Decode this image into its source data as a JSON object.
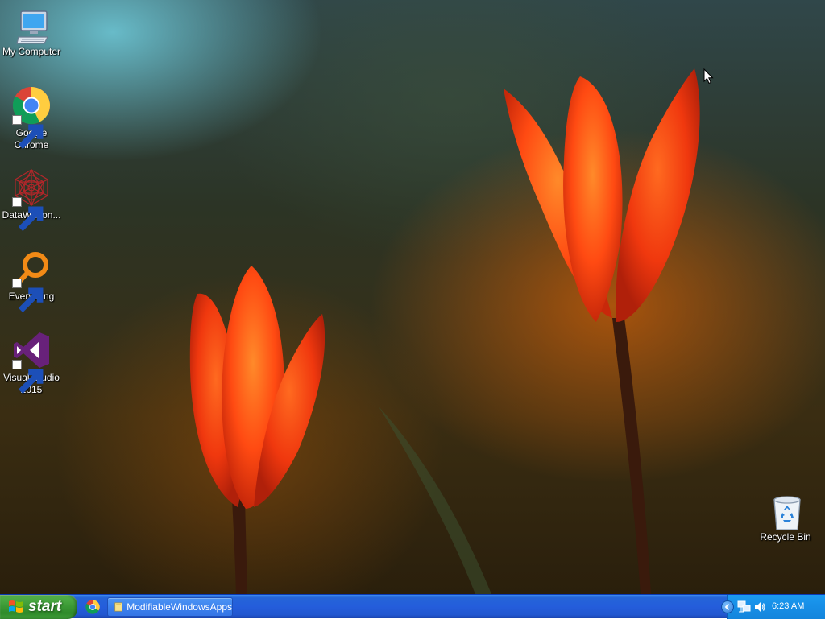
{
  "desktop": {
    "icons": [
      {
        "label": "My Computer",
        "icon": "my-computer-icon"
      },
      {
        "label": "Google Chrome",
        "icon": "chrome-icon"
      },
      {
        "label": "DataWagon...",
        "icon": "datawagon-icon"
      },
      {
        "label": "Everything",
        "icon": "everything-search-icon"
      },
      {
        "label": "Visual Studio 2015",
        "icon": "visual-studio-icon"
      },
      {
        "label": "Recycle Bin",
        "icon": "recycle-bin-icon"
      }
    ]
  },
  "taskbar": {
    "start_label": "start",
    "quick_launch": [
      {
        "icon": "chrome-icon"
      }
    ],
    "tasks": [
      {
        "label": "ModifiableWindowsApps",
        "icon": "folder-icon"
      }
    ],
    "tray": {
      "icons": [
        "expand-tray-icon",
        "network-icon",
        "volume-icon"
      ],
      "clock": "6:23 AM"
    }
  },
  "colors": {
    "taskbar_blue": "#245ddb",
    "start_green": "#3c9a36",
    "tray_blue": "#1790e8"
  }
}
